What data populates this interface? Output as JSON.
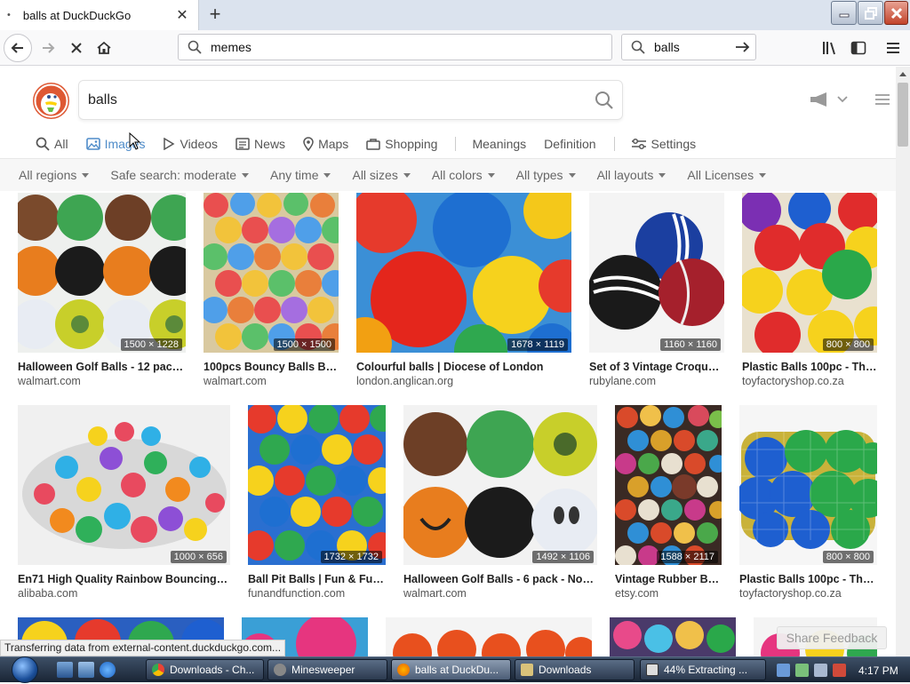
{
  "browser": {
    "tab_title": "balls at DuckDuckGo",
    "url_value": "memes",
    "search_value": "balls"
  },
  "page": {
    "query": "balls",
    "tabs": [
      {
        "label": "All",
        "icon": "search-icon"
      },
      {
        "label": "Images",
        "icon": "image-icon"
      },
      {
        "label": "Videos",
        "icon": "play-icon"
      },
      {
        "label": "News",
        "icon": "news-icon"
      },
      {
        "label": "Maps",
        "icon": "map-pin-icon"
      },
      {
        "label": "Shopping",
        "icon": "shopping-bag-icon"
      },
      {
        "label": "Meanings",
        "icon": ""
      },
      {
        "label": "Definition",
        "icon": ""
      },
      {
        "label": "Settings",
        "icon": "sliders-icon"
      }
    ],
    "active_tab": "Images",
    "filters": [
      "All regions",
      "Safe search: moderate",
      "Any time",
      "All sizes",
      "All colors",
      "All types",
      "All layouts",
      "All Licenses"
    ],
    "results": [
      {
        "title": "Halloween Golf Balls - 12 pack -...",
        "source": "walmart.com",
        "dims": "1500 × 1228"
      },
      {
        "title": "100pcs Bouncy Balls Bul...",
        "source": "walmart.com",
        "dims": "1500 × 1500"
      },
      {
        "title": "Colourful balls | Diocese of London",
        "source": "london.anglican.org",
        "dims": "1678 × 1119"
      },
      {
        "title": "Set of 3 Vintage Croquet...",
        "source": "rubylane.com",
        "dims": "1160 × 1160"
      },
      {
        "title": "Plastic Balls 100pc - The ...",
        "source": "toyfactoryshop.co.za",
        "dims": "800 × 800"
      },
      {
        "title": "En71 High Quality Rainbow Bouncing Ba...",
        "source": "alibaba.com",
        "dims": "1000 × 656"
      },
      {
        "title": "Ball Pit Balls | Fun & Funct...",
        "source": "funandfunction.com",
        "dims": "1732 × 1732"
      },
      {
        "title": "Halloween Golf Balls - 6 pack - Novel...",
        "source": "walmart.com",
        "dims": "1492 × 1106"
      },
      {
        "title": "Vintage Rubber Bo...",
        "source": "etsy.com",
        "dims": "1588 × 2117"
      },
      {
        "title": "Plastic Balls 100pc - The T...",
        "source": "toyfactoryshop.co.za",
        "dims": "800 × 800"
      }
    ],
    "status": "Transferring data from external-content.duckduckgo.com...",
    "feedback": "Share Feedback"
  },
  "taskbar": {
    "tasks": [
      {
        "label": "Downloads - Ch...",
        "icon_color": "#4285f4"
      },
      {
        "label": "Minesweeper",
        "icon_color": "#888888"
      },
      {
        "label": "balls at DuckDu...",
        "icon_color": "#e66000"
      },
      {
        "label": "Downloads",
        "icon_color": "#d9c27a"
      },
      {
        "label": "44% Extracting ...",
        "icon_color": "#dddddd"
      }
    ],
    "clock": "4:17 PM"
  },
  "colors": {
    "accent": "#4f8cc9",
    "ddg_orange": "#de5833"
  }
}
